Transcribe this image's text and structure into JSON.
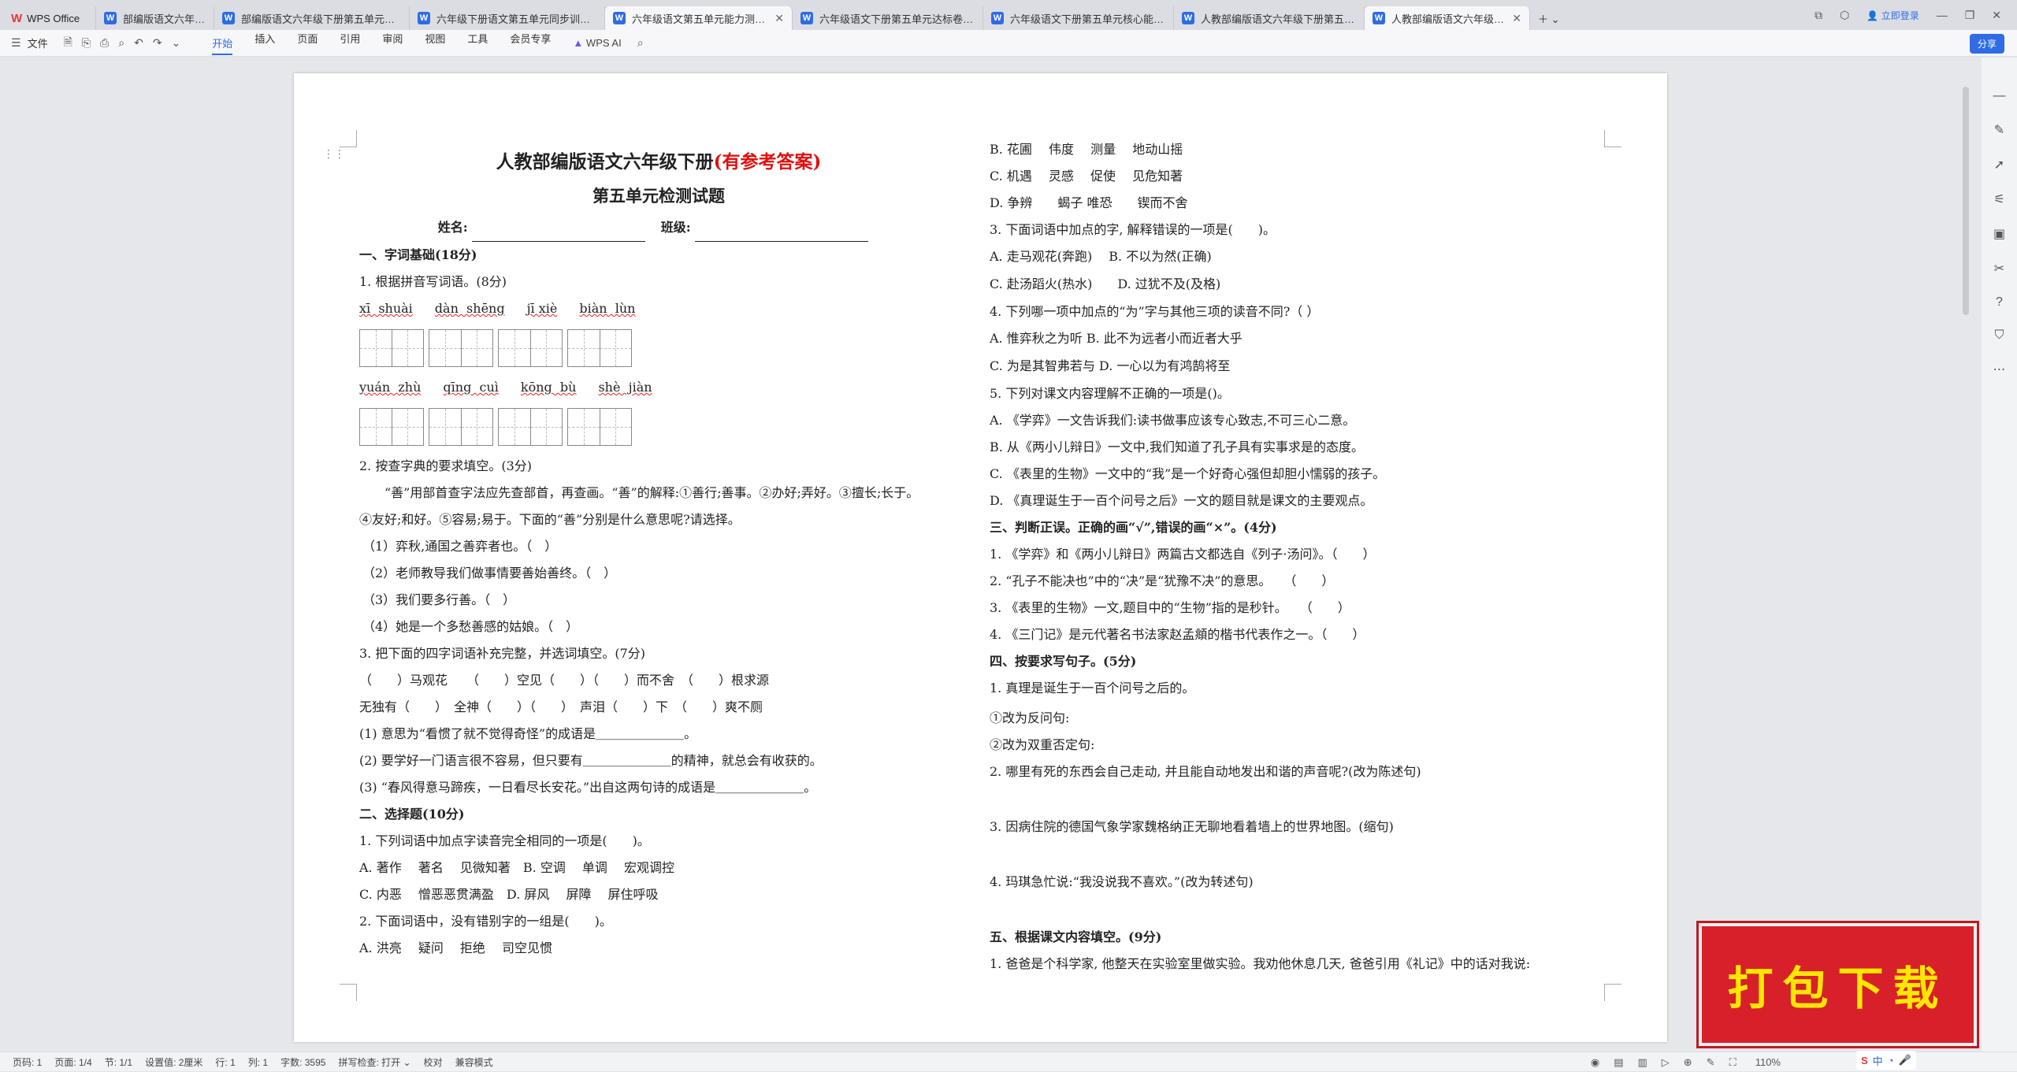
{
  "app": {
    "logo_label": "WPS Office"
  },
  "tabs": [
    {
      "label": "部编版语文六年级下册第五单元综合"
    },
    {
      "label": "部编版语文六年级下册第五单元综合"
    },
    {
      "label": "六年级下册语文第五单元同步训练卷"
    },
    {
      "label": "六年级语文第五单元能力测试卷（"
    },
    {
      "label": "六年级语文下册第五单元达标卷（有答"
    },
    {
      "label": "六年级语文下册第五单元核心能力达"
    },
    {
      "label": "人教部编版语文六年级下册第五单元"
    },
    {
      "label": "人教部编版语文六年级下册第五"
    }
  ],
  "tabbar_right": {
    "login": "立即登录"
  },
  "toolbar": {
    "file": "文件",
    "menus": [
      "开始",
      "插入",
      "页面",
      "引用",
      "审阅",
      "视图",
      "工具",
      "会员专享"
    ],
    "active": "开始",
    "wps_ai": "WPS AI",
    "share": "分享"
  },
  "doc": {
    "title_main": "人教部编版语文六年级下册",
    "title_red": "(有参考答案)",
    "title_sub": "第五单元检测试题",
    "name_label": "姓名:",
    "class_label": "班级:",
    "left": {
      "s1": "一、字词基础(18分)",
      "q1": "1. 根据拼音写词语。(8分)",
      "pinyin1": [
        "xī  shuài",
        "dàn  shēng",
        "jī xiè",
        "biàn  lùn"
      ],
      "pinyin2": [
        "yuán  zhù",
        "qīng  cuì",
        "kōng  bù",
        "shè  jiàn"
      ],
      "q2": "2. 按查字典的要求填空。(3分)",
      "q2_text1": "　　“善”用部首查字法应先查部首，再查画。“善”的解释:①善行;善事。②办好;弄好。③擅长;长于。",
      "q2_text2": "④友好;和好。⑤容易;易于。下面的“善”分别是什么意思呢?请选择。",
      "q2_items": [
        "（1）弈秋,通国之善弈者也。（　）",
        "（2）老师教导我们做事情要善始善终。（　）",
        "（3）我们要多行善。（　）",
        "（4）她是一个多愁善感的姑娘。（　）"
      ],
      "q3": "3. 把下面的四字词语补充完整，并选词填空。(7分)",
      "q3_line1": "（　　）马观花　　（　　）空见（　　）（　　）而不舍　（　　）根求源",
      "q3_line2": "无独有（　　）　全神（　　）（　　）　声泪（　　）下　（　　）爽不厕",
      "q3_items": [
        "(1) 意思为“看惯了就不觉得奇怪”的成语是＿＿＿＿＿＿＿。",
        "(2) 要学好一门语言很不容易，但只要有＿＿＿＿＿＿＿的精神，就总会有收获的。",
        "(3) “春风得意马蹄疾，一日看尽长安花。”出自这两句诗的成语是＿＿＿＿＿＿＿。"
      ],
      "s2": "二、选择题(10分)",
      "c1": "1. 下列词语中加点字读音完全相同的一项是(　　)。",
      "c1_ab": "A. 著作　 著名　 见微知著　B. 空调　 单调　 宏观调控",
      "c1_cd": "C. 内恶　 憎恶恶贯满盈　D. 屏风　 屏障　 屏住呼吸",
      "c2": "2. 下面词语中，没有错别字的一组是(　　)。",
      "c2_a": "A. 洪亮　 疑问　 拒绝　 司空见惯"
    },
    "right": {
      "lines": [
        {
          "t": "B. 花圃　 伟度　 测量　 地动山摇",
          "b": false
        },
        {
          "t": "C. 机遇　 灵感　 促使　 见危知著",
          "b": false
        },
        {
          "t": "D. 争辨　　蝎子 唯恐　　锲而不舍",
          "b": false
        },
        {
          "t": "3. 下面词语中加点的字, 解释错误的一项是(　　)。",
          "b": false
        },
        {
          "t": "A. 走马观花(奔跑)　 B. 不以为然(正确)",
          "b": false
        },
        {
          "t": "C. 赴汤蹈火(热水)　　D. 过犹不及(及格)",
          "b": false
        },
        {
          "t": "4. 下列哪一项中加点的“为”字与其他三项的读音不同?（ ）",
          "b": false
        },
        {
          "t": "A. 惟弈秋之为听 B. 此不为远者小而近者大乎",
          "b": false
        },
        {
          "t": "C. 为是其智弗若与 D. 一心以为有鸿鹄将至",
          "b": false
        },
        {
          "t": "5. 下列对课文内容理解不正确的一项是()。",
          "b": false
        },
        {
          "t": "A. 《学弈》一文告诉我们:读书做事应该专心致志,不可三心二意。",
          "b": false
        },
        {
          "t": "B. 从《两小儿辩日》一文中,我们知道了孔子具有实事求是的态度。",
          "b": false
        },
        {
          "t": "C. 《表里的生物》一文中的“我”是一个好奇心强但却胆小懦弱的孩子。",
          "b": false
        },
        {
          "t": "D. 《真理诞生于一百个问号之后》一文的题目就是课文的主要观点。",
          "b": false
        },
        {
          "t": "三、判断正误。正确的画“√”,错误的画“×”。(4分)",
          "b": true
        },
        {
          "t": "1. 《学弈》和《两小儿辩日》两篇古文都选自《列子·汤问》。（　　）",
          "b": false
        },
        {
          "t": "2. “孔子不能决也”中的“决”是“犹豫不决”的意思。　　（　　）",
          "b": false
        },
        {
          "t": "3. 《表里的生物》一文,题目中的“生物”指的是秒针。　　（　　）",
          "b": false
        },
        {
          "t": "4. 《三门记》是元代著名书法家赵孟頫的楷书代表作之一。（　　）",
          "b": false
        },
        {
          "t": "四、按要求写句子。(5分)",
          "b": true
        },
        {
          "t": "1. 真理是诞生于一百个问号之后的。",
          "b": false
        }
      ],
      "lines2": [
        {
          "t": "①改为反问句:",
          "gap": 38
        },
        {
          "t": "②改为双重否定句:",
          "gap": 34
        },
        {
          "t": "2. 哪里有死的东西会自己走动, 并且能自动地发出和谐的声音呢?(改为陈述句)",
          "gap": 34
        },
        {
          "t": "3. 因病住院的德国气象学家魏格纳正无聊地看着墙上的世界地图。(缩句)",
          "gap": 70
        },
        {
          "t": "4. 玛琪急忙说:“我没说我不喜欢。”(改为转述句)",
          "gap": 70
        }
      ],
      "s5": "五、根据课文内容填空。(9分)",
      "s5_q1": "1. 爸爸是个科学家, 他整天在实验室里做实验。我劝他休息几天, 爸爸引用《礼记》中的话对我说:"
    }
  },
  "status": {
    "page_num": "页码: 1",
    "pages": "页面: 1/4",
    "section": "节: 1/1",
    "setting": "设置值: 2厘米",
    "row": "行: 1",
    "col": "列: 1",
    "words": "字数: 3595",
    "spell": "拼写检查: 打开",
    "proof": "校对",
    "compat": "兼容模式",
    "zoom": "110%"
  },
  "promo": {
    "text": "打包下载"
  },
  "ime": {
    "text": "中"
  }
}
